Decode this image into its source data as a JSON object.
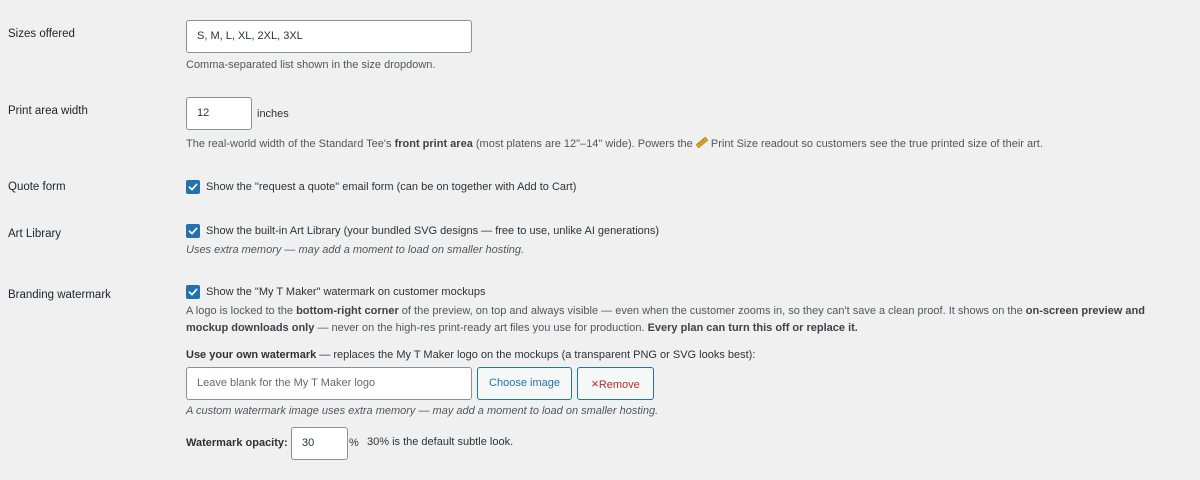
{
  "sizes": {
    "label": "Sizes offered",
    "value": "S, M, L, XL, 2XL, 3XL",
    "description": "Comma-separated list shown in the size dropdown."
  },
  "print_area": {
    "label": "Print area width",
    "value": "12",
    "unit": "inches",
    "desc_part1": "The real-world width of the Standard Tee's ",
    "desc_bold": "front print area",
    "desc_part2": " (most platens are 12\"–14\" wide). Powers the ",
    "desc_icon": "ruler-emoji",
    "desc_part3": " Print Size readout so customers see the true printed size of their art."
  },
  "quote_form": {
    "label": "Quote form",
    "checked": true,
    "checkbox_label": "Show the \"request a quote\" email form (can be on together with Add to Cart)"
  },
  "art_library": {
    "label": "Art Library",
    "checked": true,
    "checkbox_label": "Show the built-in Art Library (your bundled SVG designs — free to use, unlike AI generations)",
    "note": "Uses extra memory — may add a moment to load on smaller hosting."
  },
  "watermark": {
    "label": "Branding watermark",
    "checked": true,
    "checkbox_label": "Show the \"My T Maker\" watermark on customer mockups",
    "desc_a": "A logo is locked to the ",
    "desc_b": "bottom-right corner",
    "desc_c": " of the preview, on top and always visible — even when the customer zooms in, so they can't save a clean proof. It shows on the ",
    "desc_d": "on-screen preview and",
    "desc_e": "mockup downloads only",
    "desc_f": " — never on the high-res print-ready art files you use for production. ",
    "desc_g": "Every plan can turn this off or replace it.",
    "own_title": "Use your own watermark",
    "own_rest": " — replaces the My T Maker logo on the mockups (a transparent PNG or SVG looks best):",
    "own_placeholder": "Leave blank for the My T Maker logo",
    "choose_button": "Choose image",
    "remove_button": "Remove",
    "remove_icon": "×",
    "custom_note": "A custom watermark image uses extra memory — may add a moment to load on smaller hosting.",
    "opacity_label": "Watermark opacity:",
    "opacity_value": "30",
    "opacity_unit": "%",
    "opacity_hint": "30% is the default subtle look."
  },
  "colors": {
    "background": "#f0f0f1",
    "accent": "#2271b1",
    "danger": "#b32d2e"
  }
}
